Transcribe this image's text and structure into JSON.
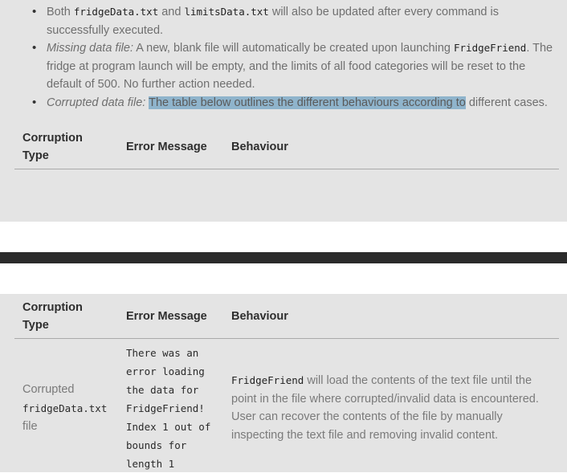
{
  "bullets": [
    {
      "pre": "Both ",
      "code1": "fridgeData.txt",
      "mid": " and ",
      "code2": "limitsData.txt",
      "post": " will also be updated after every command is successfully executed."
    },
    {
      "label": "Missing data file:",
      "pre": " A new, blank file will automatically be created upon launching ",
      "code": "FridgeFriend",
      "post": ". The fridge at program launch will be empty, and the limits of all food categories will be reset to the default of 500. No further action needed."
    },
    {
      "label": "Corrupted data file:",
      "pre": " ",
      "highlight": "The table below outlines the different behaviours according to",
      "post": " different cases."
    }
  ],
  "table_headers": {
    "col1_line1": "Corruption",
    "col1_line2": "Type",
    "col2": "Error Message",
    "col3": "Behaviour"
  },
  "row": {
    "type_line1": "Corrupted",
    "type_code": "fridgeData.txt",
    "type_line3": "file",
    "error_lines": [
      "There was an",
      "error loading",
      "the data for",
      "FridgeFriend!",
      "Index 1 out of",
      "bounds for",
      "length 1"
    ],
    "behaviour_code": "FridgeFriend",
    "behaviour_text": " will load the contents of the text file until the point in the file where corrupted/invalid data is encountered. User can recover the contents of the file by manually inspecting the text file and removing invalid content."
  }
}
